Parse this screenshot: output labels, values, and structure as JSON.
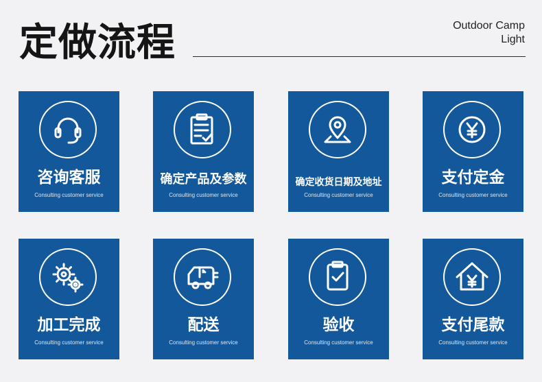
{
  "header": {
    "title": "定做流程",
    "subtitle_line1": "Outdoor Camp",
    "subtitle_line2": "Light"
  },
  "colors": {
    "card_bg": "#12589a",
    "page_bg": "#f2f2f4",
    "icon": "#ffffff"
  },
  "steps": [
    {
      "title": "咨询客服",
      "subtitle": "Consulting customer service",
      "icon": "headset-icon"
    },
    {
      "title": "确定产品及参数",
      "subtitle": "Consulting customer service",
      "icon": "clipboard-list-icon"
    },
    {
      "title": "确定收货日期及地址",
      "subtitle": "Consulting customer service",
      "icon": "map-pin-icon"
    },
    {
      "title": "支付定金",
      "subtitle": "Consulting customer service",
      "icon": "yen-coin-icon"
    },
    {
      "title": "加工完成",
      "subtitle": "Consulting customer service",
      "icon": "gears-icon"
    },
    {
      "title": "配送",
      "subtitle": "Consulting customer service",
      "icon": "delivery-truck-icon"
    },
    {
      "title": "验收",
      "subtitle": "Consulting customer service",
      "icon": "clipboard-check-icon"
    },
    {
      "title": "支付尾款",
      "subtitle": "Consulting customer service",
      "icon": "yen-house-icon"
    }
  ]
}
